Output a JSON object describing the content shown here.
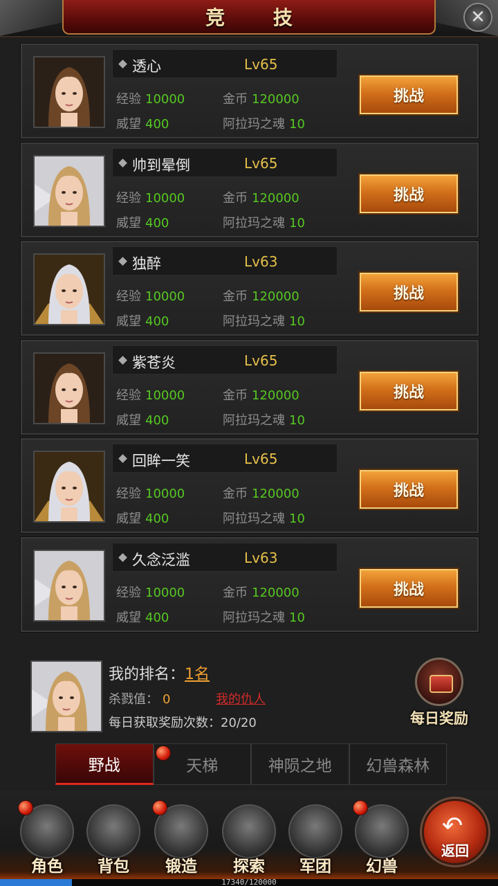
{
  "header": {
    "title": "竞  技",
    "close_icon": "close-x-icon"
  },
  "players": [
    {
      "name": "透心",
      "level": "Lv65",
      "exp_label": "经验",
      "exp": "10000",
      "gold_label": "金币",
      "gold": "120000",
      "prestige_label": "威望",
      "prestige": "400",
      "soul_label": "阿拉玛之魂",
      "soul": "10",
      "button": "挑战",
      "avatar": "female-brown-hair"
    },
    {
      "name": "帅到晕倒",
      "level": "Lv65",
      "exp_label": "经验",
      "exp": "10000",
      "gold_label": "金币",
      "gold": "120000",
      "prestige_label": "威望",
      "prestige": "400",
      "soul_label": "阿拉玛之魂",
      "soul": "10",
      "button": "挑战",
      "avatar": "female-blonde-winged"
    },
    {
      "name": "独醉",
      "level": "Lv63",
      "exp_label": "经验",
      "exp": "10000",
      "gold_label": "金币",
      "gold": "120000",
      "prestige_label": "威望",
      "prestige": "400",
      "soul_label": "阿拉玛之魂",
      "soul": "10",
      "button": "挑战",
      "avatar": "male-silver-hair"
    },
    {
      "name": "紫苍炎",
      "level": "Lv65",
      "exp_label": "经验",
      "exp": "10000",
      "gold_label": "金币",
      "gold": "120000",
      "prestige_label": "威望",
      "prestige": "400",
      "soul_label": "阿拉玛之魂",
      "soul": "10",
      "button": "挑战",
      "avatar": "female-brown-hair"
    },
    {
      "name": "回眸一笑",
      "level": "Lv65",
      "exp_label": "经验",
      "exp": "10000",
      "gold_label": "金币",
      "gold": "120000",
      "prestige_label": "威望",
      "prestige": "400",
      "soul_label": "阿拉玛之魂",
      "soul": "10",
      "button": "挑战",
      "avatar": "male-silver-hair"
    },
    {
      "name": "久念泛滥",
      "level": "Lv63",
      "exp_label": "经验",
      "exp": "10000",
      "gold_label": "金币",
      "gold": "120000",
      "prestige_label": "威望",
      "prestige": "400",
      "soul_label": "阿拉玛之魂",
      "soul": "10",
      "button": "挑战",
      "avatar": "female-blonde-winged"
    }
  ],
  "my": {
    "rank_label": "我的排名：",
    "rank_value": "1名",
    "kill_label": "杀戮值：",
    "kill_value": "0",
    "enemy_link": "我的仇人",
    "reward_count_text": "每日获取奖励次数：20/20",
    "daily_reward_label": "每日奖励"
  },
  "tabs": [
    {
      "label": "野战",
      "active": true
    },
    {
      "label": "天梯",
      "active": false
    },
    {
      "label": "神陨之地",
      "active": false
    },
    {
      "label": "幻兽森林",
      "active": false
    }
  ],
  "nav": [
    {
      "label": "角色",
      "icon": "helmet-icon",
      "badge": true
    },
    {
      "label": "背包",
      "icon": "bag-icon",
      "badge": false
    },
    {
      "label": "锻造",
      "icon": "hammer-icon",
      "badge": true
    },
    {
      "label": "探索",
      "icon": "magnifier-icon",
      "badge": false
    },
    {
      "label": "军团",
      "icon": "gauntlet-icon",
      "badge": false
    },
    {
      "label": "幻兽",
      "icon": "beast-icon",
      "badge": true
    }
  ],
  "back_label": "返回",
  "exp_bar": {
    "text": "17340/120000",
    "progress": 0.1445
  },
  "colors": {
    "accent_gold": "#e6c04a",
    "value_green": "#56c822",
    "button_orange": "#d2701a",
    "danger_red": "#d12a2a"
  }
}
